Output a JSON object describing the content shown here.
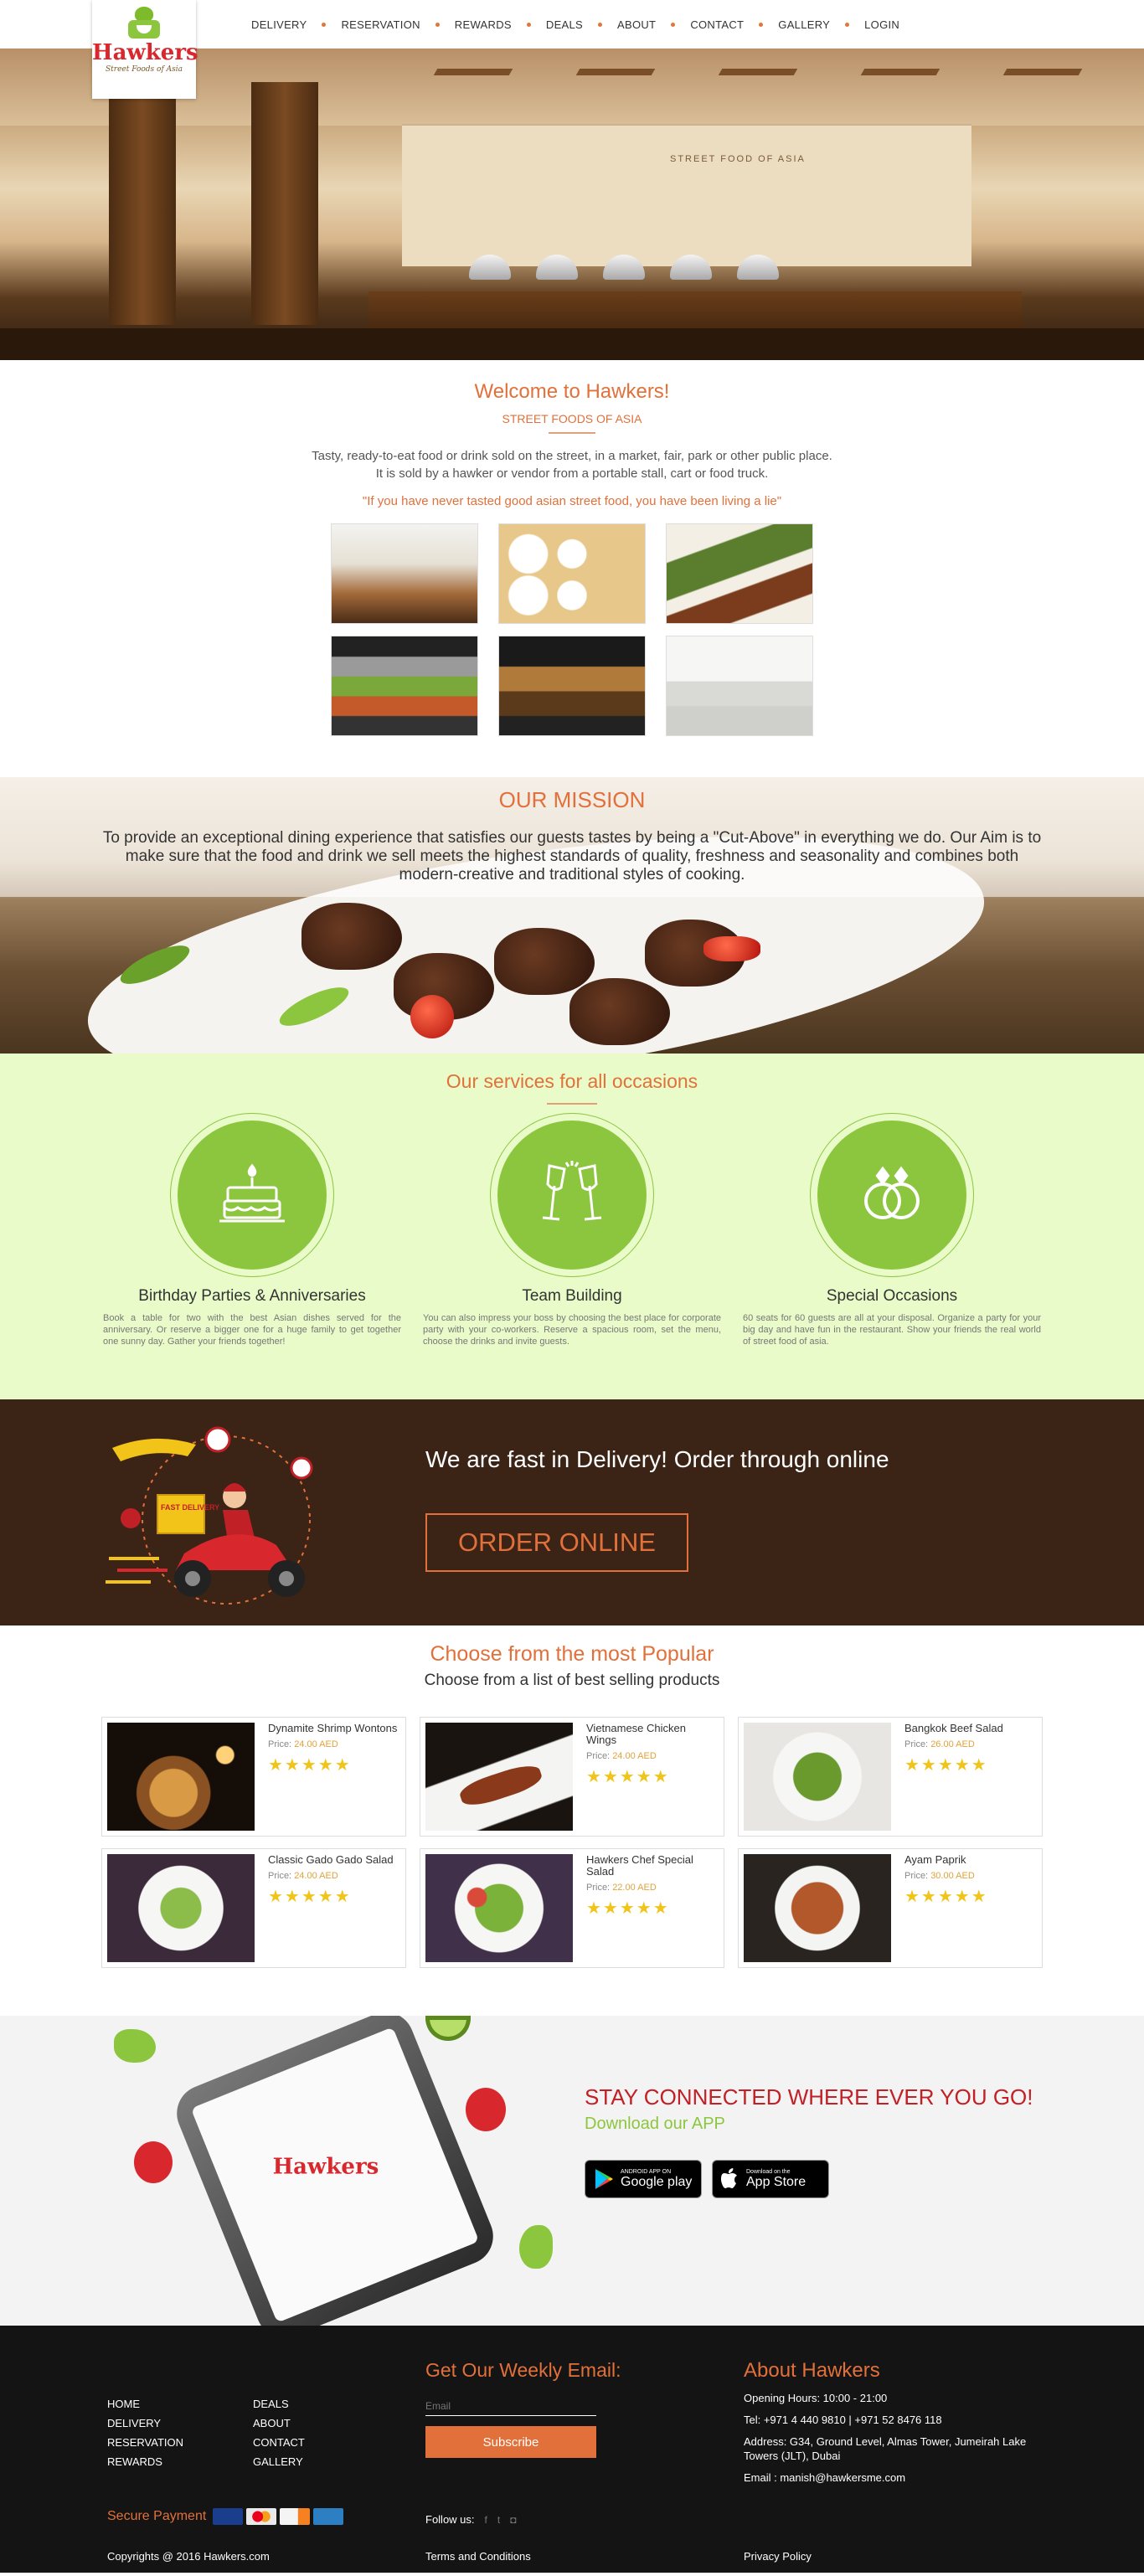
{
  "nav": {
    "logo_name": "Hawkers",
    "logo_tagline": "Street Foods of Asia",
    "items": [
      {
        "label": "DELIVERY"
      },
      {
        "label": "RESERVATION"
      },
      {
        "label": "REWARDS"
      },
      {
        "label": "DEALS"
      },
      {
        "label": "ABOUT"
      },
      {
        "label": "CONTACT"
      },
      {
        "label": "GALLERY"
      },
      {
        "label": "LOGIN"
      }
    ]
  },
  "hero": {
    "wall_text": "STREET FOOD OF ASIA"
  },
  "welcome": {
    "title": "Welcome to Hawkers!",
    "subtitle": "STREET FOODS OF ASIA",
    "line1": "Tasty, ready-to-eat food or drink sold on the street, in a market, fair, park or other public place.",
    "line2": "It is sold by a hawker or vendor from a portable stall, cart or food truck.",
    "quote": "\"If you have never tasted good asian street food, you have been living a lie\""
  },
  "mission": {
    "title": "OUR MISSION",
    "text": "To provide an exceptional dining experience that satisfies our guests tastes by being a \"Cut-Above\" in everything we do. Our Aim is to make sure that the food and drink we sell meets the highest standards of quality, freshness and seasonality and combines both modern-creative and traditional styles of cooking."
  },
  "services": {
    "title": "Our services for all occasions",
    "items": [
      {
        "title": "Birthday Parties & Anniversaries",
        "icon": "birthday-cake-icon",
        "text": "Book a table for two with the best Asian dishes served for the anniversary. Or reserve a bigger one for a huge family to get together one sunny day. Gather your friends together!"
      },
      {
        "title": "Team Building",
        "icon": "champagne-glasses-icon",
        "text": "You can also impress your boss by choosing the best place for corporate party with your co-workers. Reserve a spacious room, set the menu, choose the drinks and invite guests."
      },
      {
        "title": "Special Occasions",
        "icon": "wedding-rings-icon",
        "text": "60 seats for 60 guests are all at your disposal. Organize a party for your big day and have fun in the restaurant. Show your friends the real world of street food of asia."
      }
    ]
  },
  "delivery": {
    "headline": "We are fast in Delivery! Order through online",
    "button": "ORDER ONLINE",
    "badge_text": "FAST DELIVERY",
    "box_text": "FAST DELIVERY"
  },
  "popular": {
    "title": "Choose from the most Popular",
    "subtitle": "Choose from a list of best selling products",
    "price_label": "Price:",
    "products": [
      {
        "name": "Dynamite Shrimp Wontons",
        "price": "24.00 AED",
        "rating": 5
      },
      {
        "name": "Vietnamese Chicken Wings",
        "price": "24.00 AED",
        "rating": 5
      },
      {
        "name": "Bangkok Beef Salad",
        "price": "26.00 AED",
        "rating": 5
      },
      {
        "name": "Classic Gado Gado Salad",
        "price": "24.00 AED",
        "rating": 5
      },
      {
        "name": "Hawkers Chef Special Salad",
        "price": "22.00 AED",
        "rating": 5
      },
      {
        "name": "Ayam Paprik",
        "price": "30.00 AED",
        "rating": 5
      }
    ]
  },
  "app": {
    "headline": "STAY CONNECTED WHERE EVER YOU GO!",
    "subheadline": "Download our APP",
    "phone_logo": "Hawkers",
    "google_small": "ANDROID APP ON",
    "google_big": "Google play",
    "apple_small": "Download on the",
    "apple_big": "App Store"
  },
  "footer": {
    "links_col1": [
      "HOME",
      "DELIVERY",
      "RESERVATION",
      "REWARDS"
    ],
    "links_col2": [
      "DEALS",
      "ABOUT",
      "CONTACT",
      "GALLERY"
    ],
    "secure_label": "Secure Payment",
    "cards": [
      {
        "name": "VISA",
        "color": "#1a3e8c"
      },
      {
        "name": "MasterCard",
        "color": "#e9e9e9"
      },
      {
        "name": "DISCOVER",
        "color": "#f4f4f4"
      },
      {
        "name": "AMEX",
        "color": "#2b7fc2"
      }
    ],
    "email_title": "Get Our Weekly Email:",
    "email_placeholder": "Email",
    "subscribe": "Subscribe",
    "follow_label": "Follow us:",
    "about_title": "About Hawkers",
    "hours": "Opening Hours: 10:00 - 21:00",
    "tel": "Tel: +971 4 440 9810 | +971 52 8476 118",
    "address": "Address: G34, Ground Level, Almas Tower, Jumeirah Lake Towers (JLT), Dubai",
    "email": "Email : manish@hawkersme.com",
    "copyright": "Copyrights @ 2016 Hawkers.com",
    "terms": "Terms and Conditions",
    "privacy": "Privacy Policy"
  },
  "colors": {
    "accent": "#e2703a",
    "green": "#8cc63f",
    "service_bg": "#e9fbc9",
    "delivery_bg": "#3b2316",
    "footer_bg": "#141414",
    "red": "#c12026"
  }
}
